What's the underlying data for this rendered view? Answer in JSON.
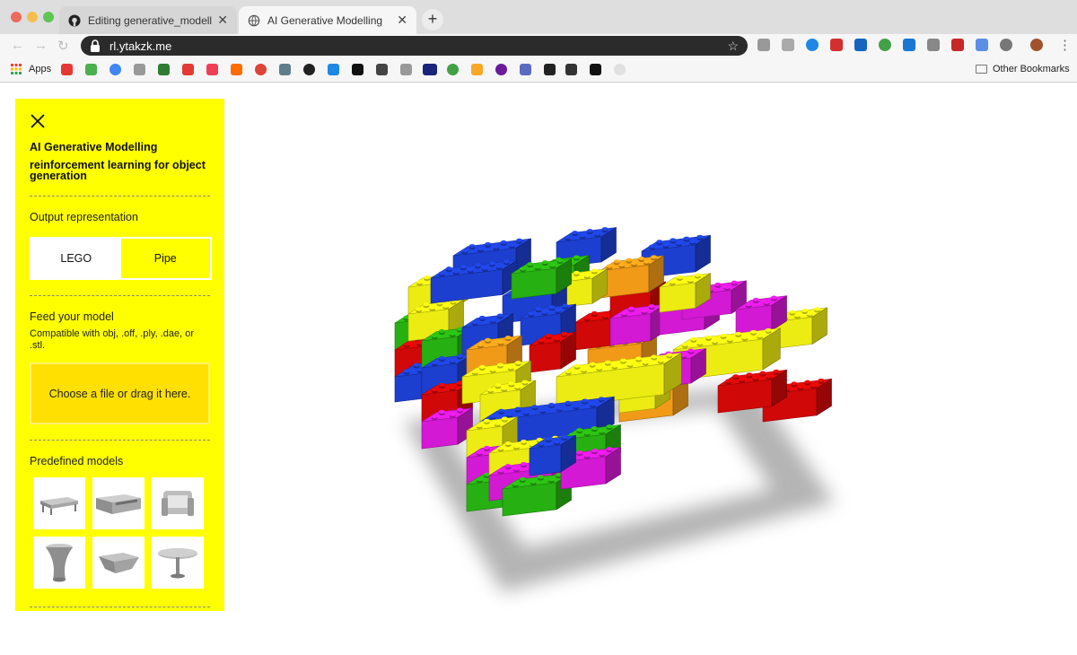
{
  "browser": {
    "tabs": [
      {
        "title": "Editing generative_modelling_w",
        "active": false
      },
      {
        "title": "AI Generative Modelling",
        "active": true
      }
    ],
    "url": "rl.ytakzk.me",
    "bookmarks": {
      "apps_label": "Apps",
      "other_label": "Other Bookmarks"
    }
  },
  "panel": {
    "title": "AI Generative Modelling",
    "subtitle": "reinforcement learning for object generation",
    "output_label": "Output representation",
    "options": [
      "LEGO",
      "Pipe"
    ],
    "selected_option": "LEGO",
    "feed_label": "Feed your model",
    "compat_text": "Compatible with obj, .off, .ply, .dae, or .stl.",
    "dropzone_text": "Choose a file or drag it here.",
    "predefined_label": "Predefined models",
    "models": [
      "coffee-table",
      "tv-stand",
      "armchair",
      "hourglass-stool",
      "tapered-table",
      "round-table"
    ]
  },
  "colors": {
    "panel": "#ffff00",
    "dropzone": "#ffe000",
    "lego_blue": "#1d3fcf",
    "lego_yellow": "#ecec12",
    "lego_red": "#d00808",
    "lego_green": "#27b012",
    "lego_orange": "#f09a18",
    "lego_magenta": "#d319d3"
  }
}
